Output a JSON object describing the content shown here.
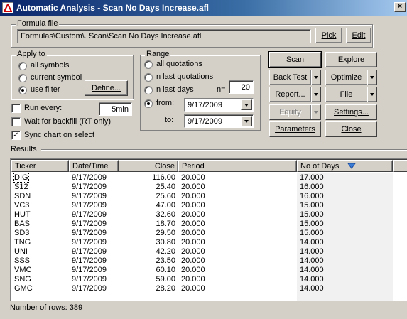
{
  "window": {
    "title": "Automatic Analysis - Scan No Days Increase.afl"
  },
  "formula": {
    "legend": "Formula file",
    "path": "Formulas\\Custom\\. Scan\\Scan No Days Increase.afl",
    "pick_label": "Pick",
    "edit_label": "Edit"
  },
  "apply_to": {
    "legend": "Apply to",
    "options": [
      "all symbols",
      "current symbol",
      "use filter"
    ],
    "selected": "use filter",
    "define_label": "Define..."
  },
  "range": {
    "legend": "Range",
    "options": [
      "all quotations",
      "n last quotations",
      "n last days",
      "from:"
    ],
    "selected": "from:",
    "n_label": "n=",
    "n_value": "20",
    "from_value": "9/17/2009",
    "to_label": "to:",
    "to_value": "9/17/2009"
  },
  "options": {
    "run_every_label": "Run every:",
    "run_every_value": "5min",
    "run_every_checked": false,
    "wait_backfill_label": "Wait for backfill (RT only)",
    "wait_backfill_checked": false,
    "sync_chart_label": "Sync chart on select",
    "sync_chart_checked": true
  },
  "buttons": {
    "scan": "Scan",
    "explore": "Explore",
    "back_test": "Back Test",
    "optimize": "Optimize",
    "report": "Report...",
    "file": "File",
    "equity": "Equity",
    "settings": "Settings...",
    "parameters": "Parameters",
    "close": "Close"
  },
  "results": {
    "label": "Results",
    "columns": [
      "Ticker",
      "Date/Time",
      "Close",
      "Period",
      "No of Days"
    ],
    "rows": [
      [
        "DIG",
        "9/17/2009",
        "116.00",
        "20.000",
        "17.000"
      ],
      [
        "S12",
        "9/17/2009",
        "25.40",
        "20.000",
        "16.000"
      ],
      [
        "SDN",
        "9/17/2009",
        "25.60",
        "20.000",
        "16.000"
      ],
      [
        "VC3",
        "9/17/2009",
        "47.00",
        "20.000",
        "15.000"
      ],
      [
        "HUT",
        "9/17/2009",
        "32.60",
        "20.000",
        "15.000"
      ],
      [
        "BAS",
        "9/17/2009",
        "18.70",
        "20.000",
        "15.000"
      ],
      [
        "SD3",
        "9/17/2009",
        "29.50",
        "20.000",
        "15.000"
      ],
      [
        "TNG",
        "9/17/2009",
        "30.80",
        "20.000",
        "14.000"
      ],
      [
        "UNI",
        "9/17/2009",
        "42.20",
        "20.000",
        "14.000"
      ],
      [
        "SSS",
        "9/17/2009",
        "23.50",
        "20.000",
        "14.000"
      ],
      [
        "VMC",
        "9/17/2009",
        "60.10",
        "20.000",
        "14.000"
      ],
      [
        "SNG",
        "9/17/2009",
        "59.00",
        "20.000",
        "14.000"
      ],
      [
        "GMC",
        "9/17/2009",
        "28.20",
        "20.000",
        "14.000"
      ]
    ],
    "status": "Number of rows: 389"
  }
}
